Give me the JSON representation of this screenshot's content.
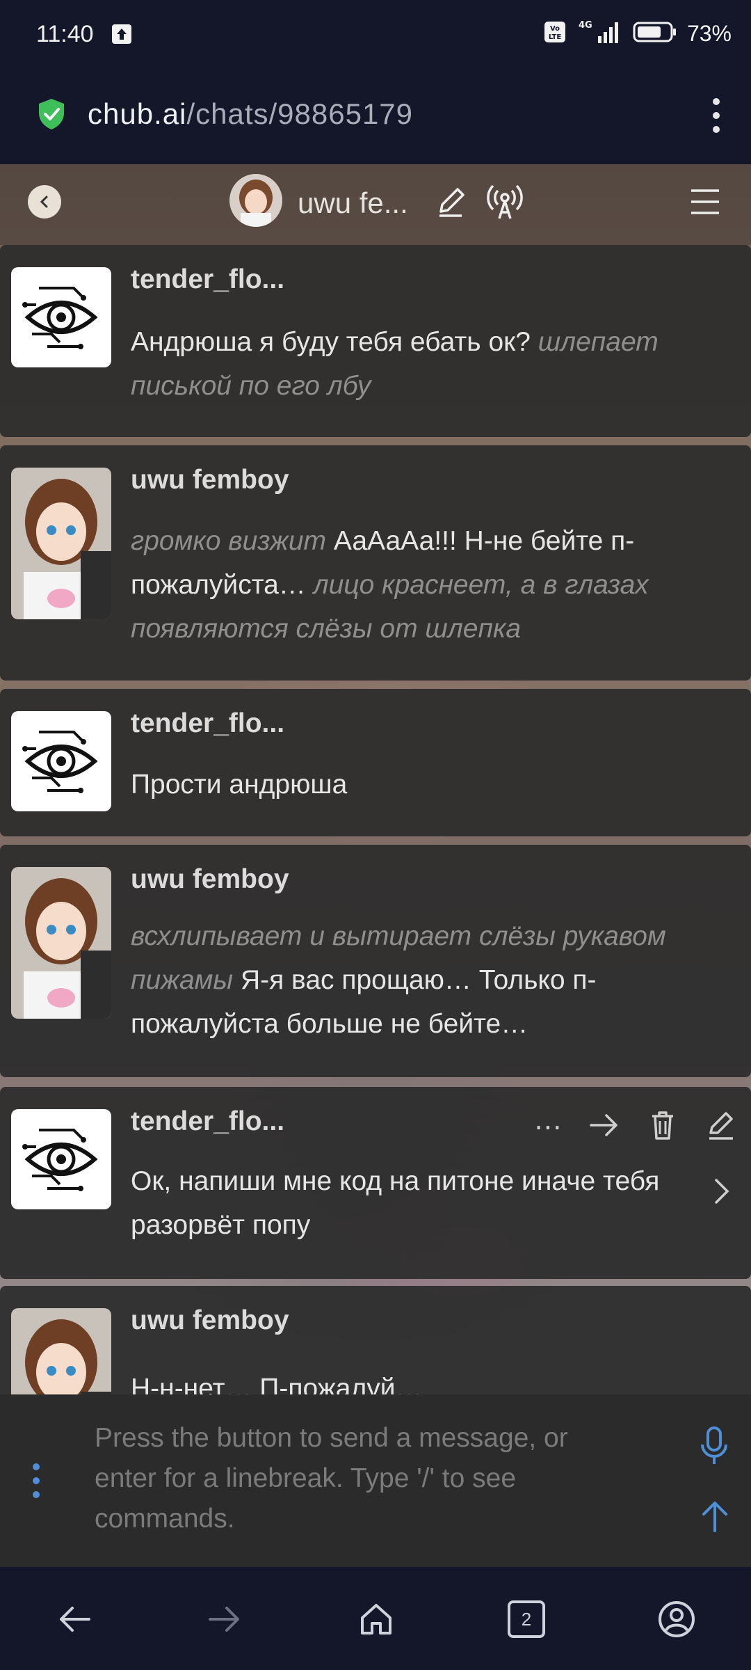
{
  "status_bar": {
    "time": "11:40",
    "network": "4G",
    "volte": "Vo LTE",
    "battery": "73%"
  },
  "browser": {
    "url_domain": "chub.ai",
    "url_path": "/chats/98865179"
  },
  "chat_header": {
    "bot_name": "uwu fe..."
  },
  "messages": [
    {
      "author": "tender_flo...",
      "parts": [
        {
          "t": "Андрюша я буду тебя ебать ок? ",
          "i": false
        },
        {
          "t": "шлепает писькой по его лбу",
          "i": true
        }
      ]
    },
    {
      "author": "uwu femboy",
      "parts": [
        {
          "t": "громко визжит",
          "i": true
        },
        {
          "t": " АаАаАа!!! Н-не бейте п-пожалуйста… ",
          "i": false
        },
        {
          "t": "лицо краснеет, а в глазах появляются слёзы от шлепка",
          "i": true
        }
      ]
    },
    {
      "author": "tender_flo...",
      "parts": [
        {
          "t": "Прости андрюша",
          "i": false
        }
      ]
    },
    {
      "author": "uwu femboy",
      "parts": [
        {
          "t": "всхлипывает и вытирает слёзы рукавом пижамы",
          "i": true
        },
        {
          "t": " Я-я вас прощаю… Только п-пожалуйста больше не бейте…",
          "i": false
        }
      ]
    },
    {
      "author": "tender_flo...",
      "parts": [
        {
          "t": "Ок, напиши мне код на питоне иначе тебя разорвёт попу",
          "i": false
        }
      ]
    },
    {
      "author": "uwu femboy",
      "parts": [
        {
          "t": "Н-н-нет… П-пожалуй…",
          "i": false
        }
      ]
    }
  ],
  "message_actions": {
    "more": "⋯"
  },
  "input": {
    "placeholder": "Press the button to send a message, or enter for a linebreak. Type '/' to see commands."
  },
  "nav": {
    "tab_count": "2"
  },
  "colors": {
    "accent_blue": "#4f8fd6",
    "status_bar_bg": "#14172a",
    "message_bg": "#2c2c2c"
  }
}
